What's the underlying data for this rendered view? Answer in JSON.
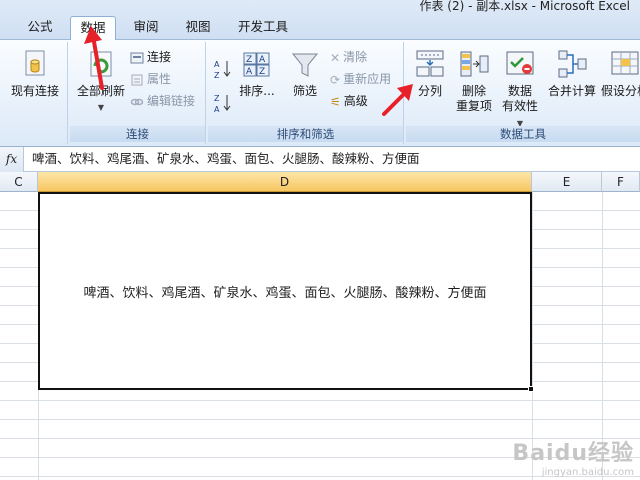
{
  "window": {
    "title": "作表 (2) - 副本.xlsx - Microsoft Excel"
  },
  "tabs": [
    {
      "label": "公式"
    },
    {
      "label": "数据"
    },
    {
      "label": "审阅"
    },
    {
      "label": "视图"
    },
    {
      "label": "开发工具"
    }
  ],
  "ribbon": {
    "existing_connections": "现有连接",
    "refresh_all": "全部刷新",
    "connections": "连接",
    "properties": "属性",
    "edit_links": "编辑链接",
    "group_connections": "连接",
    "sort": "排序...",
    "filter": "筛选",
    "clear": "清除",
    "reapply": "重新应用",
    "advanced": "高级",
    "group_sort_filter": "排序和筛选",
    "text_to_columns": "分列",
    "remove_duplicates_1": "删除",
    "remove_duplicates_2": "重复项",
    "data_validation_1": "数据",
    "data_validation_2": "有效性",
    "consolidate": "合并计算",
    "what_if": "假设分析",
    "group_data_tools": "数据工具"
  },
  "formula_bar": {
    "fx": "fx",
    "content": "啤酒、饮料、鸡尾酒、矿泉水、鸡蛋、面包、火腿肠、酸辣粉、方便面"
  },
  "columns": [
    "C",
    "D",
    "E",
    "F"
  ],
  "cell": {
    "value": "啤酒、饮料、鸡尾酒、矿泉水、鸡蛋、面包、火腿肠、酸辣粉、方便面"
  },
  "watermark": {
    "line1": "Baidu经验",
    "line2": "jingyan.baidu.com"
  },
  "colors": {
    "accent": "#e8202a",
    "selected_header": "#f7c662",
    "ribbon": "#dce9f7"
  }
}
